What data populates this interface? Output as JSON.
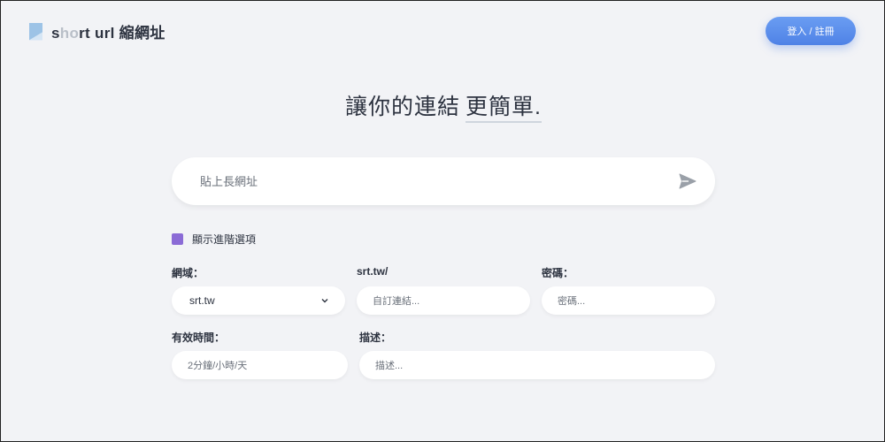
{
  "header": {
    "logo_prefix_dark": "s",
    "logo_prefix_fade": "ho",
    "logo_rest": "rt url 縮網址",
    "login_label": "登入 / 註冊"
  },
  "hero": {
    "headline": "讓你的連結",
    "headline_emph": "更簡單."
  },
  "url_input": {
    "placeholder": "貼上長網址",
    "value": ""
  },
  "advanced": {
    "label": "顯示進階選項",
    "checked": true
  },
  "form": {
    "domain_label": "網域：",
    "domain_value": "srt.tw",
    "slug_label": "srt.tw/",
    "slug_placeholder": "自訂連結...",
    "password_label": "密碼：",
    "password_placeholder": "密碼...",
    "expiry_label": "有效時間：",
    "expiry_placeholder": "2分鐘/小時/天",
    "description_label": "描述：",
    "description_placeholder": "描述..."
  },
  "colors": {
    "background": "#f2f3f6",
    "primary": "#5b8ff0",
    "checkbox": "#8b6bd6",
    "text": "#2d3340"
  }
}
